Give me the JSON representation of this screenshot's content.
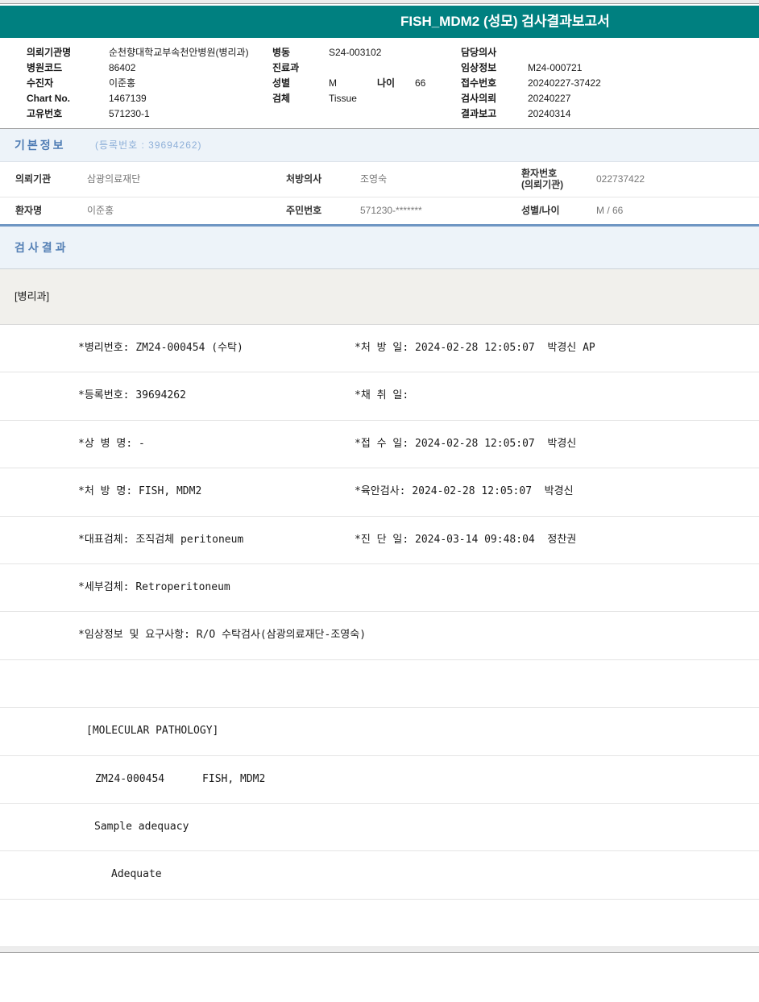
{
  "colors": {
    "teal_header": "#008080",
    "section_title_blue": "#5580b5",
    "band_background": "#edf3f9",
    "department_band_background": "#f1f0ec",
    "divider_blue": "#6e96c3"
  },
  "title_bar": {
    "title": "FISH_MDM2 (성모) 검사결과보고서"
  },
  "patient_header": {
    "left": [
      {
        "label": "의뢰기관명",
        "value": "순천향대학교부속천안병원(병리과)"
      },
      {
        "label": "병원코드",
        "value": "86402"
      },
      {
        "label": "수진자",
        "value": "이준홍"
      },
      {
        "label": "Chart No.",
        "value": "1467139"
      },
      {
        "label": "고유번호",
        "value": "571230-1"
      }
    ],
    "middle": [
      {
        "label": "병동",
        "value": "S24-003102"
      },
      {
        "label": "진료과",
        "value": ""
      },
      {
        "label": "성별",
        "value": "M"
      },
      {
        "label": "검체",
        "value": "Tissue"
      }
    ],
    "age": {
      "label": "나이",
      "value": "66"
    },
    "right": [
      {
        "label": "담당의사",
        "value": ""
      },
      {
        "label": "임상정보",
        "value": "M24-000721"
      },
      {
        "label": "접수번호",
        "value": "20240227-37422"
      },
      {
        "label": "검사의뢰",
        "value": "20240227"
      },
      {
        "label": "결과보고",
        "value": "20240314"
      }
    ]
  },
  "basic_info": {
    "section_title": "기본정보",
    "reg_note": "(등록번호 : 39694262)",
    "row1": {
      "c1_label": "의뢰기관",
      "c1_value": "삼광의료재단",
      "c2_label": "처방의사",
      "c2_value": "조영숙",
      "c3_label_line1": "환자번호",
      "c3_label_line2": "(의뢰기관)",
      "c3_value": "022737422"
    },
    "row2": {
      "c1_label": "환자명",
      "c1_value": "이준홍",
      "c2_label": "주민번호",
      "c2_value": "571230-*******",
      "c3_label": "성별/나이",
      "c3_value": "M / 66"
    }
  },
  "results": {
    "section_title": "검사결과",
    "department": "[병리과]",
    "rows": [
      {
        "left": "*병리번호: ZM24-000454 (수탁)",
        "right": "*처 방 일: 2024-02-28 12:05:07  박경신 AP"
      },
      {
        "left": "*등록번호: 39694262",
        "right": "*채 취 일:"
      },
      {
        "left": "*상 병 명: -",
        "right": "*접 수 일: 2024-02-28 12:05:07  박경신"
      },
      {
        "left": "*처 방 명: FISH, MDM2",
        "right": "*육안검사: 2024-02-28 12:05:07  박경신"
      },
      {
        "left": "*대표검체: 조직검체 peritoneum",
        "right": "*진 단 일: 2024-03-14 09:48:04  정찬권"
      },
      {
        "left": "*세부검체: Retroperitoneum",
        "right": ""
      },
      {
        "left": "*임상정보 및 요구사항: R/O 수탁검사(삼광의료재단-조영숙)",
        "right": ""
      },
      {
        "left": "",
        "right": ""
      },
      {
        "left": "[MOLECULAR PATHOLOGY]",
        "right": ""
      },
      {
        "left": "ZM24-000454      FISH, MDM2",
        "right": ""
      },
      {
        "left": "Sample adequacy",
        "right": ""
      },
      {
        "left": "Adequate",
        "right": ""
      },
      {
        "left": "",
        "right": ""
      }
    ]
  }
}
